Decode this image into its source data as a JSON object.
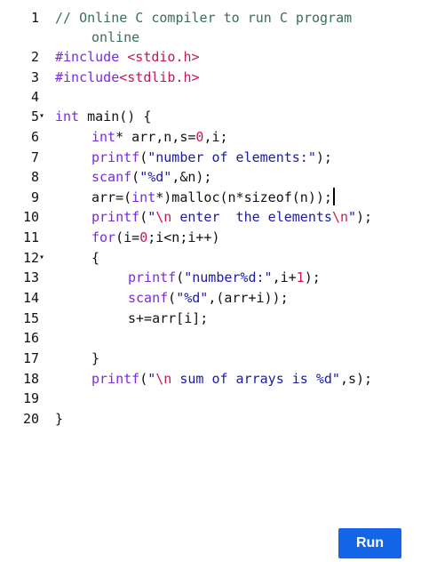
{
  "editor": {
    "lines": [
      {
        "num": "1",
        "fold": "",
        "indent": 0,
        "tokens": [
          {
            "t": "// Online C compiler to run C program",
            "c": "cm"
          }
        ]
      },
      {
        "num": "",
        "fold": "",
        "indent": 2,
        "tokens": [
          {
            "t": "online",
            "c": "cm"
          }
        ]
      },
      {
        "num": "2",
        "fold": "",
        "indent": 0,
        "tokens": [
          {
            "t": "#include ",
            "c": "pp"
          },
          {
            "t": "<stdio.h>",
            "c": "hdr"
          }
        ]
      },
      {
        "num": "3",
        "fold": "",
        "indent": 0,
        "tokens": [
          {
            "t": "#include",
            "c": "pp"
          },
          {
            "t": "<stdlib.h>",
            "c": "hdr"
          }
        ]
      },
      {
        "num": "4",
        "fold": "",
        "indent": 0,
        "tokens": []
      },
      {
        "num": "5",
        "fold": "▾",
        "indent": 0,
        "tokens": [
          {
            "t": "int",
            "c": "kw"
          },
          {
            "t": " main() {",
            "c": ""
          }
        ]
      },
      {
        "num": "6",
        "fold": "",
        "indent": 2,
        "tokens": [
          {
            "t": "int",
            "c": "kw"
          },
          {
            "t": "* arr,n,s=",
            "c": ""
          },
          {
            "t": "0",
            "c": "num"
          },
          {
            "t": ",i;",
            "c": ""
          }
        ]
      },
      {
        "num": "7",
        "fold": "",
        "indent": 2,
        "tokens": [
          {
            "t": "printf",
            "c": "fn"
          },
          {
            "t": "(",
            "c": ""
          },
          {
            "t": "\"number of elements:\"",
            "c": "str"
          },
          {
            "t": ");",
            "c": ""
          }
        ]
      },
      {
        "num": "8",
        "fold": "",
        "indent": 2,
        "tokens": [
          {
            "t": "scanf",
            "c": "fn"
          },
          {
            "t": "(",
            "c": ""
          },
          {
            "t": "\"%d\"",
            "c": "str"
          },
          {
            "t": ",&n);",
            "c": ""
          }
        ]
      },
      {
        "num": "9",
        "fold": "",
        "indent": 2,
        "caret": true,
        "tokens": [
          {
            "t": "arr=(",
            "c": ""
          },
          {
            "t": "int",
            "c": "kw"
          },
          {
            "t": "*)malloc(n*sizeof(n));",
            "c": ""
          }
        ]
      },
      {
        "num": "10",
        "fold": "",
        "indent": 2,
        "tokens": [
          {
            "t": "printf",
            "c": "fn"
          },
          {
            "t": "(",
            "c": ""
          },
          {
            "t": "\"",
            "c": "str"
          },
          {
            "t": "\\n",
            "c": "esc"
          },
          {
            "t": " enter  the elements",
            "c": "str"
          },
          {
            "t": "\\n",
            "c": "esc"
          },
          {
            "t": "\"",
            "c": "str"
          },
          {
            "t": ");",
            "c": ""
          }
        ]
      },
      {
        "num": "11",
        "fold": "",
        "indent": 2,
        "tokens": [
          {
            "t": "for",
            "c": "kw"
          },
          {
            "t": "(i=",
            "c": ""
          },
          {
            "t": "0",
            "c": "num"
          },
          {
            "t": ";i<n;i++)",
            "c": ""
          }
        ]
      },
      {
        "num": "12",
        "fold": "▾",
        "indent": 2,
        "tokens": [
          {
            "t": "{",
            "c": ""
          }
        ]
      },
      {
        "num": "13",
        "fold": "",
        "indent": 4,
        "tokens": [
          {
            "t": "printf",
            "c": "fn"
          },
          {
            "t": "(",
            "c": ""
          },
          {
            "t": "\"number%d:\"",
            "c": "str"
          },
          {
            "t": ",i+",
            "c": ""
          },
          {
            "t": "1",
            "c": "num"
          },
          {
            "t": ");",
            "c": ""
          }
        ]
      },
      {
        "num": "14",
        "fold": "",
        "indent": 4,
        "tokens": [
          {
            "t": "scanf",
            "c": "fn"
          },
          {
            "t": "(",
            "c": ""
          },
          {
            "t": "\"%d\"",
            "c": "str"
          },
          {
            "t": ",(arr+i));",
            "c": ""
          }
        ]
      },
      {
        "num": "15",
        "fold": "",
        "indent": 4,
        "tokens": [
          {
            "t": "s+=arr[i];",
            "c": ""
          }
        ]
      },
      {
        "num": "16",
        "fold": "",
        "indent": 0,
        "tokens": []
      },
      {
        "num": "17",
        "fold": "",
        "indent": 2,
        "tokens": [
          {
            "t": "}",
            "c": ""
          }
        ]
      },
      {
        "num": "18",
        "fold": "",
        "indent": 2,
        "tokens": [
          {
            "t": "printf",
            "c": "fn"
          },
          {
            "t": "(",
            "c": ""
          },
          {
            "t": "\"",
            "c": "str"
          },
          {
            "t": "\\n",
            "c": "esc"
          },
          {
            "t": " sum of arrays is %d\"",
            "c": "str"
          },
          {
            "t": ",s);",
            "c": ""
          }
        ]
      },
      {
        "num": "19",
        "fold": "",
        "indent": 0,
        "tokens": []
      },
      {
        "num": "20",
        "fold": "",
        "indent": 0,
        "tokens": [
          {
            "t": "}",
            "c": ""
          }
        ]
      }
    ]
  },
  "toolbar": {
    "run_label": "Run"
  },
  "colors": {
    "accent": "#1565e8",
    "comment": "#3a6d5e",
    "keyword": "#7a2be0",
    "string": "#1a1aa6",
    "number": "#c2185b"
  }
}
